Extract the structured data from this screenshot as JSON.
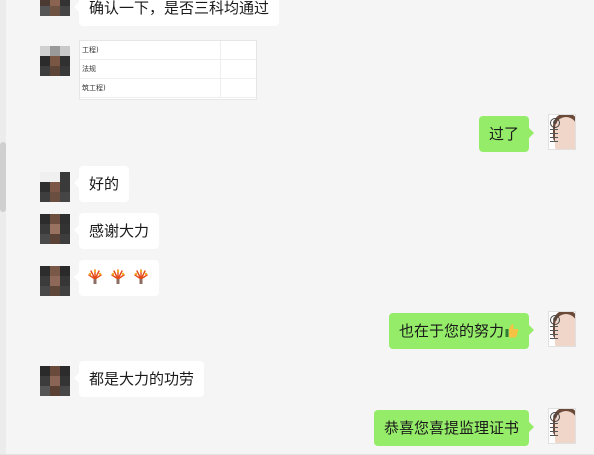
{
  "messages": [
    {
      "side": "in",
      "text": "确认一下，是否三科均通过"
    },
    {
      "side": "in",
      "kind": "document",
      "rows": [
        "工程)",
        "法规",
        "筑工程)"
      ]
    },
    {
      "side": "out",
      "text": "过了"
    },
    {
      "side": "in",
      "text": "好的"
    },
    {
      "side": "in",
      "text": "感谢大力"
    },
    {
      "side": "in",
      "kind": "emoji",
      "emoji": "firework-emoji",
      "count": 3
    },
    {
      "side": "out",
      "text": "也在于您的努力",
      "emoji": "thumbs-up-emoji"
    },
    {
      "side": "in",
      "text": "都是大力的功劳"
    },
    {
      "side": "out",
      "text": "恭喜您喜提监理证书"
    }
  ],
  "colors": {
    "background": "#f5f5f5",
    "incoming_bubble": "#ffffff",
    "outgoing_bubble": "#95ec69"
  }
}
